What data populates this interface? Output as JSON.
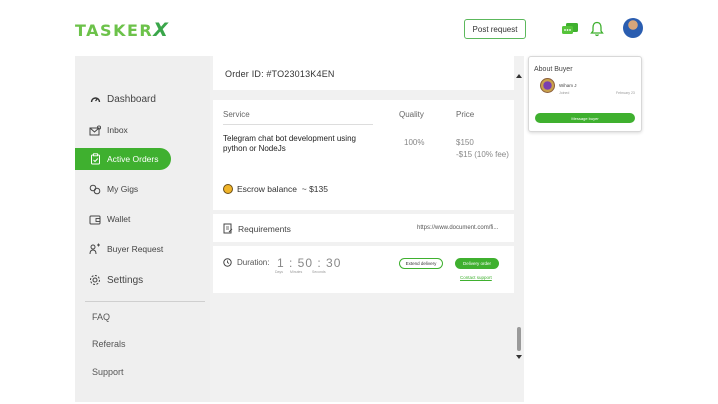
{
  "header": {
    "logo_text": "TASKER",
    "logo_x": "X",
    "post_request_label": "Post request",
    "icons": [
      "chat-icon",
      "bell-icon",
      "avatar"
    ]
  },
  "sidebar": {
    "items": [
      {
        "label": "Dashboard",
        "icon": "gauge-icon"
      },
      {
        "label": "Inbox",
        "icon": "inbox-icon"
      },
      {
        "label": "Active Orders",
        "icon": "clipboard-icon",
        "active": true
      },
      {
        "label": "My Gigs",
        "icon": "gigs-icon"
      },
      {
        "label": "Wallet",
        "icon": "wallet-icon"
      },
      {
        "label": "Buyer Request",
        "icon": "buyer-request-icon"
      },
      {
        "label": "Settings",
        "icon": "gear-icon"
      }
    ],
    "secondary": [
      "FAQ",
      "Referals",
      "Support"
    ]
  },
  "order": {
    "id_label": "Order ID:",
    "id_value": "#TO23013K4EN"
  },
  "service_table": {
    "headers": {
      "service": "Service",
      "quality": "Quality",
      "price": "Price"
    },
    "row": {
      "service": "Telegram chat bot development using python or NodeJs",
      "quality": "100%",
      "price": "$150",
      "fee": "-$15   (10% fee)"
    }
  },
  "escrow": {
    "label": "Escrow balance",
    "value": "~ $135"
  },
  "requirements": {
    "label": "Requirements",
    "url": "https://www.document.com/fi..."
  },
  "duration": {
    "label": "Duration:",
    "time": "1 : 50 : 30",
    "units": [
      "Days",
      "Minutes",
      "Seconds"
    ],
    "extend_label": "Extend delivery",
    "deliver_label": "Delivery order",
    "contact_label": "Contact support"
  },
  "about_buyer": {
    "title": "About Buyer",
    "name": "Wiham J",
    "joined": "Joined",
    "date": "February 23",
    "message_label": "Message buyer"
  },
  "colors": {
    "accent": "#3fb02f",
    "logo": "#6cc24a",
    "sidebar_bg": "#efefef",
    "main_bg": "#f1f1f1"
  }
}
